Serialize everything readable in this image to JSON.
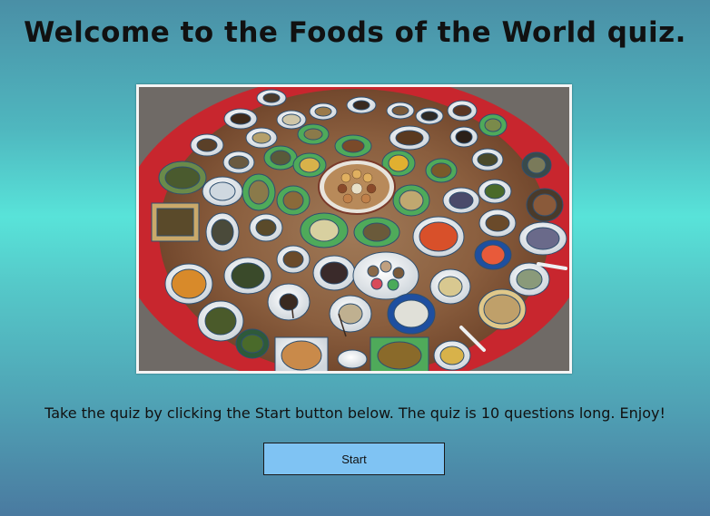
{
  "page": {
    "title": "Welcome to the Foods of the World quiz.",
    "instructions": "Take the quiz by clicking the Start button below. The quiz is 10 questions long. Enjoy!",
    "start_label": "Start"
  },
  "colors": {
    "button_bg": "#7fc3f3",
    "background_mid": "#58e3d9",
    "background_edge": "#4a7aa0",
    "table_red": "#c8262e"
  }
}
